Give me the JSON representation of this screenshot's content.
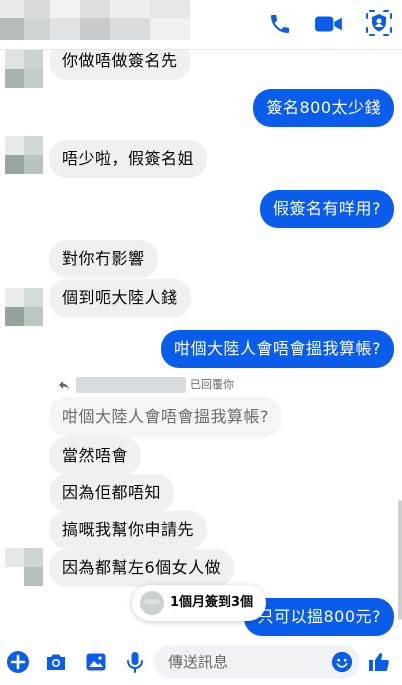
{
  "theme": {
    "accent": "#0a5dea",
    "incoming_bg": "#f0f0f0",
    "outgoing_bg": "#0a5dea"
  },
  "header": {
    "icons": [
      "phone-icon",
      "video-camera-icon",
      "shield-icon"
    ]
  },
  "messages": [
    {
      "side": "in",
      "text": "你做唔做簽名先"
    },
    {
      "side": "out",
      "text": "簽名800太少錢"
    },
    {
      "side": "in",
      "text": "唔少啦，假簽名姐"
    },
    {
      "side": "out",
      "text": "假簽名有咩用?"
    },
    {
      "side": "in",
      "text": "對你冇影響"
    },
    {
      "side": "in",
      "text": "個到呃大陸人錢"
    },
    {
      "side": "out",
      "text": "咁個大陸人會唔會搵我算帳?"
    },
    {
      "side": "in",
      "text": "當然唔會"
    },
    {
      "side": "in",
      "text": "因為佢都唔知"
    },
    {
      "side": "in",
      "text": "搞嘅我幫你申請先"
    },
    {
      "side": "in",
      "text": "因為都幫左6個女人做"
    },
    {
      "side": "out",
      "text": "只可以搵800元?"
    }
  ],
  "reply": {
    "label": "已回覆你",
    "quoted_text": "咁個大陸人會唔會搵我算帳?"
  },
  "floating_chip": {
    "icon_text": "0000",
    "text": "1個月簽到3個"
  },
  "composer": {
    "placeholder": "傳送訊息",
    "icons": [
      "plus-icon",
      "camera-icon",
      "gallery-icon",
      "microphone-icon",
      "emoji-icon",
      "thumbs-up-icon"
    ]
  }
}
